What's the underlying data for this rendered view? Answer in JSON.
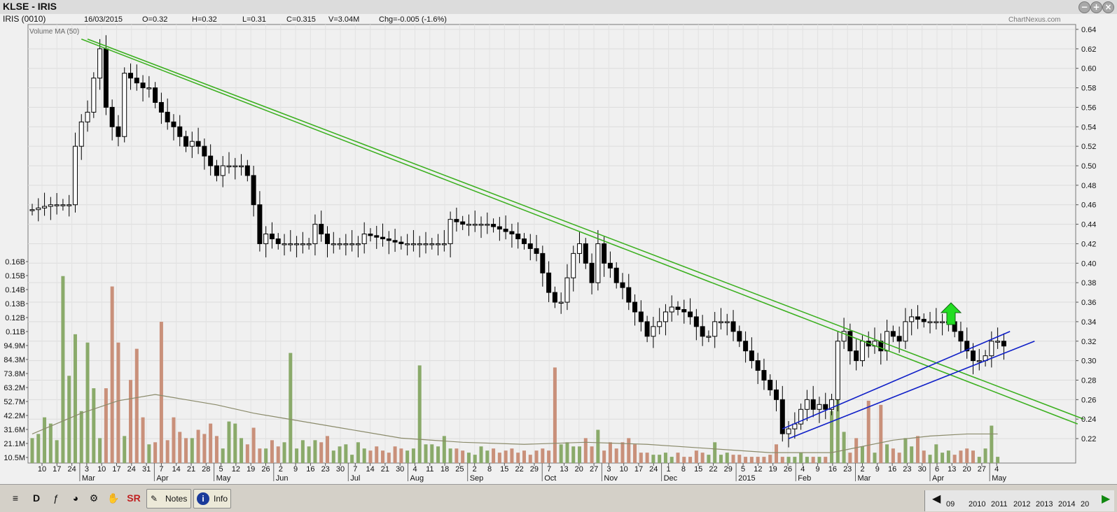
{
  "window": {
    "title": "KLSE - IRIS"
  },
  "info_bar": [
    {
      "key": "name",
      "text": "IRIS (0010)"
    },
    {
      "key": "date",
      "text": "16/03/2015"
    },
    {
      "key": "open",
      "text": "O=0.32"
    },
    {
      "key": "high",
      "text": "H=0.32"
    },
    {
      "key": "low",
      "text": "L=0.31"
    },
    {
      "key": "close",
      "text": "C=0.315"
    },
    {
      "key": "volume",
      "text": "V=3.04M"
    },
    {
      "key": "change",
      "text": "Chg=-0.005 (-1.6%)"
    }
  ],
  "watermark": "ChartNexus.com",
  "volume_ma_label": "Volume MA (50)",
  "toolbar": {
    "d_label": "D",
    "notes_label": "Notes",
    "info_label": "Info",
    "sr_label": "SR",
    "year_labels": [
      "09",
      "2010",
      "2011",
      "2012",
      "2013",
      "2014",
      "20"
    ]
  },
  "colors": {
    "up_volume": "#8aaa6a",
    "down_volume": "#c9907a",
    "trend_green": "#3cb020",
    "trend_blue": "#1020c8",
    "arrow_green": "#22dd22"
  },
  "chart_data": {
    "type": "candlestick",
    "price_axis_ticks": [
      "0.64",
      "0.62",
      "0.60",
      "0.58",
      "0.56",
      "0.54",
      "0.52",
      "0.50",
      "0.48",
      "0.46",
      "0.44",
      "0.42",
      "0.40",
      "0.38",
      "0.36",
      "0.34",
      "0.32",
      "0.30",
      "0.28",
      "0.26",
      "0.24",
      "0.22"
    ],
    "volume_axis_ticks": [
      "0.16B",
      "0.15B",
      "0.14B",
      "0.13B",
      "0.12B",
      "0.11B",
      "94.9M",
      "84.3M",
      "73.8M",
      "63.2M",
      "52.7M",
      "42.2M",
      "31.6M",
      "21.1M",
      "10.5M"
    ],
    "x_day_labels": [
      "10",
      "17",
      "24",
      "3",
      "10",
      "17",
      "24",
      "31",
      "7",
      "14",
      "21",
      "28",
      "5",
      "12",
      "19",
      "26",
      "2",
      "9",
      "16",
      "23",
      "30",
      "7",
      "14",
      "21",
      "30",
      "4",
      "11",
      "18",
      "25",
      "2",
      "8",
      "15",
      "22",
      "29",
      "7",
      "13",
      "20",
      "27",
      "3",
      "10",
      "17",
      "24",
      "1",
      "8",
      "15",
      "22",
      "29",
      "5",
      "12",
      "19",
      "26",
      "4",
      "9",
      "16",
      "23",
      "2",
      "9",
      "16",
      "23",
      "30",
      "6",
      "13",
      "20",
      "27",
      "4"
    ],
    "x_month_labels": [
      "Mar",
      "Apr",
      "May",
      "Jun",
      "Jul",
      "Aug",
      "Sep",
      "Oct",
      "Nov",
      "Dec",
      "2015",
      "Feb",
      "Mar",
      "Apr",
      "May"
    ],
    "ylim": [
      0.21,
      0.645
    ],
    "close_path": [
      [
        0,
        0.455
      ],
      [
        3,
        0.46
      ],
      [
        6,
        0.46
      ],
      [
        7,
        0.52
      ],
      [
        8,
        0.545
      ],
      [
        9,
        0.555
      ],
      [
        10,
        0.59
      ],
      [
        11,
        0.62
      ],
      [
        12,
        0.56
      ],
      [
        13,
        0.54
      ],
      [
        14,
        0.53
      ],
      [
        15,
        0.595
      ],
      [
        16,
        0.59
      ],
      [
        18,
        0.58
      ],
      [
        19,
        0.58
      ],
      [
        20,
        0.565
      ],
      [
        21,
        0.555
      ],
      [
        22,
        0.545
      ],
      [
        23,
        0.54
      ],
      [
        24,
        0.53
      ],
      [
        25,
        0.52
      ],
      [
        26,
        0.525
      ],
      [
        27,
        0.52
      ],
      [
        28,
        0.51
      ],
      [
        29,
        0.5
      ],
      [
        30,
        0.49
      ],
      [
        31,
        0.5
      ],
      [
        32,
        0.5
      ],
      [
        34,
        0.5
      ],
      [
        35,
        0.49
      ],
      [
        36,
        0.46
      ],
      [
        37,
        0.42
      ],
      [
        38,
        0.43
      ],
      [
        40,
        0.42
      ],
      [
        45,
        0.42
      ],
      [
        46,
        0.44
      ],
      [
        47,
        0.43
      ],
      [
        48,
        0.42
      ],
      [
        50,
        0.42
      ],
      [
        53,
        0.42
      ],
      [
        54,
        0.43
      ],
      [
        60,
        0.42
      ],
      [
        67,
        0.42
      ],
      [
        68,
        0.445
      ],
      [
        70,
        0.44
      ],
      [
        72,
        0.44
      ],
      [
        74,
        0.44
      ],
      [
        78,
        0.43
      ],
      [
        80,
        0.42
      ],
      [
        82,
        0.41
      ],
      [
        83,
        0.39
      ],
      [
        84,
        0.37
      ],
      [
        85,
        0.36
      ],
      [
        86,
        0.36
      ],
      [
        88,
        0.41
      ],
      [
        89,
        0.42
      ],
      [
        90,
        0.4
      ],
      [
        91,
        0.38
      ],
      [
        92,
        0.42
      ],
      [
        93,
        0.4
      ],
      [
        94,
        0.395
      ],
      [
        95,
        0.38
      ],
      [
        96,
        0.375
      ],
      [
        97,
        0.36
      ],
      [
        98,
        0.35
      ],
      [
        99,
        0.34
      ],
      [
        100,
        0.325
      ],
      [
        101,
        0.335
      ],
      [
        102,
        0.34
      ],
      [
        103,
        0.35
      ],
      [
        104,
        0.355
      ],
      [
        106,
        0.35
      ],
      [
        107,
        0.345
      ],
      [
        108,
        0.335
      ],
      [
        109,
        0.325
      ],
      [
        110,
        0.325
      ],
      [
        111,
        0.34
      ],
      [
        113,
        0.34
      ],
      [
        114,
        0.33
      ],
      [
        115,
        0.32
      ],
      [
        116,
        0.31
      ],
      [
        117,
        0.3
      ],
      [
        118,
        0.29
      ],
      [
        119,
        0.28
      ],
      [
        120,
        0.27
      ],
      [
        121,
        0.26
      ],
      [
        122,
        0.225
      ],
      [
        123,
        0.23
      ],
      [
        124,
        0.235
      ],
      [
        125,
        0.25
      ],
      [
        126,
        0.26
      ],
      [
        127,
        0.25
      ],
      [
        128,
        0.255
      ],
      [
        129,
        0.25
      ],
      [
        130,
        0.26
      ],
      [
        131,
        0.32
      ],
      [
        132,
        0.33
      ],
      [
        133,
        0.31
      ],
      [
        134,
        0.3
      ],
      [
        135,
        0.32
      ],
      [
        136,
        0.315
      ],
      [
        137,
        0.32
      ],
      [
        138,
        0.31
      ],
      [
        139,
        0.33
      ],
      [
        140,
        0.325
      ],
      [
        141,
        0.32
      ],
      [
        142,
        0.34
      ],
      [
        143,
        0.345
      ],
      [
        145,
        0.34
      ],
      [
        147,
        0.34
      ],
      [
        149,
        0.34
      ],
      [
        150,
        0.33
      ],
      [
        151,
        0.32
      ],
      [
        152,
        0.31
      ],
      [
        153,
        0.3
      ],
      [
        154,
        0.3
      ],
      [
        155,
        0.305
      ],
      [
        156,
        0.32
      ],
      [
        157,
        0.32
      ],
      [
        158,
        0.315
      ]
    ],
    "volume_bars": [
      [
        0,
        12
      ],
      [
        1,
        14
      ],
      [
        2,
        22
      ],
      [
        3,
        19
      ],
      [
        4,
        11
      ],
      [
        5,
        90
      ],
      [
        6,
        42
      ],
      [
        7,
        62
      ],
      [
        8,
        25
      ],
      [
        9,
        58
      ],
      [
        10,
        36
      ],
      [
        11,
        12
      ],
      [
        12,
        36
      ],
      [
        13,
        85
      ],
      [
        14,
        58
      ],
      [
        15,
        13
      ],
      [
        16,
        40
      ],
      [
        17,
        55
      ],
      [
        18,
        22
      ],
      [
        19,
        9
      ],
      [
        20,
        10
      ],
      [
        21,
        68
      ],
      [
        22,
        11
      ],
      [
        23,
        22
      ],
      [
        24,
        15
      ],
      [
        25,
        12
      ],
      [
        26,
        12
      ],
      [
        27,
        16
      ],
      [
        28,
        14
      ],
      [
        29,
        19
      ],
      [
        30,
        13
      ],
      [
        31,
        7
      ],
      [
        32,
        20
      ],
      [
        33,
        19
      ],
      [
        34,
        12
      ],
      [
        35,
        9
      ],
      [
        36,
        17
      ],
      [
        37,
        7
      ],
      [
        38,
        7
      ],
      [
        39,
        11
      ],
      [
        40,
        8
      ],
      [
        41,
        10
      ],
      [
        42,
        53
      ],
      [
        43,
        7
      ],
      [
        44,
        11
      ],
      [
        45,
        8
      ],
      [
        46,
        11
      ],
      [
        47,
        10
      ],
      [
        48,
        13
      ],
      [
        49,
        6
      ],
      [
        50,
        8
      ],
      [
        51,
        9
      ],
      [
        52,
        4
      ],
      [
        53,
        10
      ],
      [
        54,
        7
      ],
      [
        55,
        6
      ],
      [
        56,
        8
      ],
      [
        57,
        6
      ],
      [
        58,
        5
      ],
      [
        59,
        8
      ],
      [
        60,
        7
      ],
      [
        61,
        6
      ],
      [
        62,
        7
      ],
      [
        63,
        47
      ],
      [
        64,
        9
      ],
      [
        65,
        9
      ],
      [
        66,
        8
      ],
      [
        67,
        13
      ],
      [
        68,
        7
      ],
      [
        69,
        7
      ],
      [
        70,
        6
      ],
      [
        71,
        5
      ],
      [
        72,
        4
      ],
      [
        73,
        8
      ],
      [
        74,
        6
      ],
      [
        75,
        7
      ],
      [
        76,
        5
      ],
      [
        77,
        6
      ],
      [
        78,
        7
      ],
      [
        79,
        5
      ],
      [
        80,
        6
      ],
      [
        81,
        4
      ],
      [
        82,
        6
      ],
      [
        83,
        7
      ],
      [
        84,
        6
      ],
      [
        85,
        46
      ],
      [
        86,
        9
      ],
      [
        87,
        10
      ],
      [
        88,
        8
      ],
      [
        89,
        8
      ],
      [
        90,
        12
      ],
      [
        91,
        8
      ],
      [
        92,
        16
      ],
      [
        93,
        6
      ],
      [
        94,
        10
      ],
      [
        95,
        7
      ],
      [
        96,
        10
      ],
      [
        97,
        12
      ],
      [
        98,
        9
      ],
      [
        99,
        5
      ],
      [
        100,
        5
      ],
      [
        101,
        4
      ],
      [
        102,
        4
      ],
      [
        103,
        5
      ],
      [
        104,
        3
      ],
      [
        105,
        5
      ],
      [
        106,
        3
      ],
      [
        107,
        3
      ],
      [
        108,
        6
      ],
      [
        109,
        5
      ],
      [
        110,
        4
      ],
      [
        111,
        10
      ],
      [
        112,
        4
      ],
      [
        113,
        5
      ],
      [
        114,
        4
      ],
      [
        115,
        4
      ],
      [
        116,
        3
      ],
      [
        117,
        3
      ],
      [
        118,
        3
      ],
      [
        119,
        3
      ],
      [
        120,
        4
      ],
      [
        121,
        9
      ],
      [
        122,
        3
      ],
      [
        123,
        3
      ],
      [
        124,
        3
      ],
      [
        125,
        5
      ],
      [
        126,
        3
      ],
      [
        127,
        3
      ],
      [
        128,
        3
      ],
      [
        129,
        3
      ],
      [
        130,
        25
      ],
      [
        131,
        38
      ],
      [
        132,
        15
      ],
      [
        133,
        5
      ],
      [
        134,
        12
      ],
      [
        135,
        8
      ],
      [
        136,
        30
      ],
      [
        137,
        5
      ],
      [
        138,
        28
      ],
      [
        139,
        9
      ],
      [
        140,
        7
      ],
      [
        141,
        5
      ],
      [
        142,
        12
      ],
      [
        143,
        8
      ],
      [
        144,
        13
      ],
      [
        145,
        6
      ],
      [
        146,
        4
      ],
      [
        147,
        9
      ],
      [
        148,
        5
      ],
      [
        149,
        6
      ],
      [
        150,
        4
      ],
      [
        151,
        6
      ],
      [
        152,
        7
      ],
      [
        153,
        6
      ],
      [
        154,
        3
      ],
      [
        155,
        7
      ],
      [
        156,
        18
      ],
      [
        157,
        3
      ]
    ],
    "volume_ma": [
      [
        0,
        14
      ],
      [
        8,
        24
      ],
      [
        14,
        30
      ],
      [
        20,
        33
      ],
      [
        24,
        31
      ],
      [
        30,
        28
      ],
      [
        36,
        24
      ],
      [
        42,
        21
      ],
      [
        50,
        17
      ],
      [
        60,
        12
      ],
      [
        70,
        10
      ],
      [
        80,
        9
      ],
      [
        90,
        10
      ],
      [
        100,
        9
      ],
      [
        110,
        7
      ],
      [
        120,
        5
      ],
      [
        130,
        5
      ],
      [
        135,
        8
      ],
      [
        140,
        11
      ],
      [
        146,
        13
      ],
      [
        152,
        14
      ],
      [
        157,
        14
      ]
    ],
    "trendlines": [
      {
        "color": "green",
        "p1": [
          8,
          0.63
        ],
        "p2": [
          170,
          0.235
        ]
      },
      {
        "color": "green",
        "p1": [
          9,
          0.63
        ],
        "p2": [
          171,
          0.24
        ]
      },
      {
        "color": "blue",
        "p1": [
          122,
          0.23
        ],
        "p2": [
          159,
          0.33
        ]
      },
      {
        "color": "blue",
        "p1": [
          123,
          0.22
        ],
        "p2": [
          163,
          0.32
        ]
      }
    ],
    "bars_total": 170,
    "grid": true,
    "legend": "none"
  }
}
